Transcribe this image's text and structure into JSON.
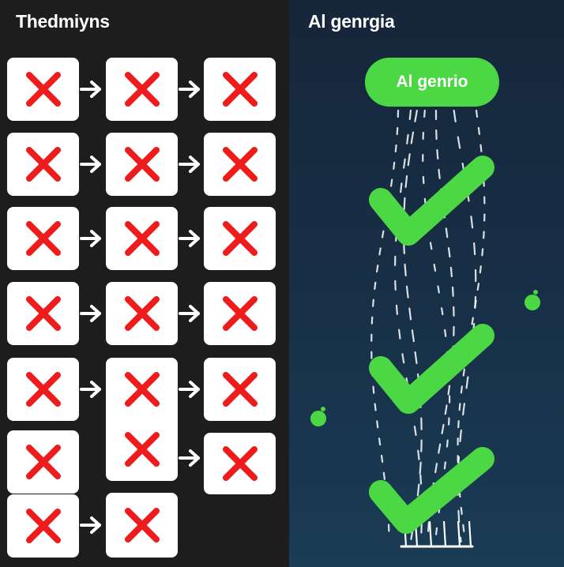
{
  "left_panel": {
    "title": "Thedmiyns"
  },
  "right_panel": {
    "title": "Al genrgia",
    "pill_label": "Al genrio"
  },
  "colors": {
    "left_bg": "#1d1d1d",
    "right_bg": "#173047",
    "cross_red": "#ee1c1c",
    "check_green": "#4cd844",
    "card_white": "#ffffff"
  },
  "icons": {
    "failure": "x-mark-icon",
    "success": "checkmark-icon",
    "flow": "arrow-right-icon"
  }
}
